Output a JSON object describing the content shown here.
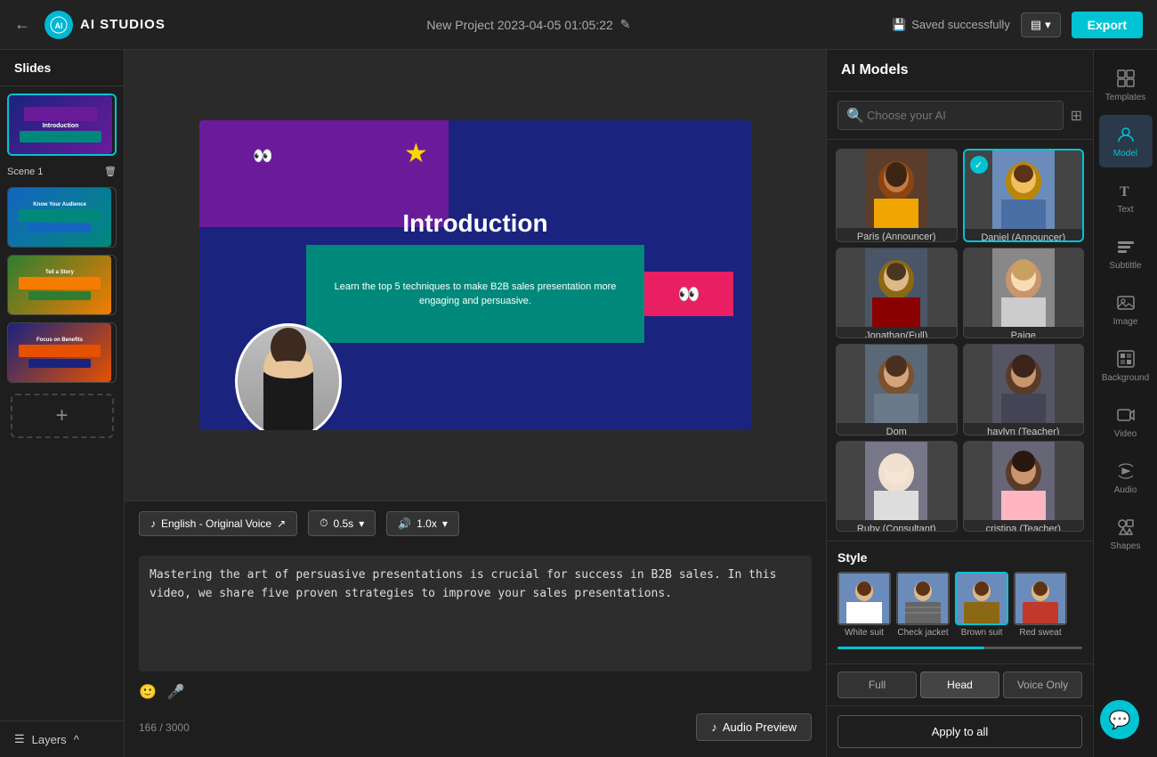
{
  "topbar": {
    "back_arrow": "←",
    "logo_text": "AI STUDIOS",
    "project_title": "New Project 2023-04-05 01:05:22",
    "edit_icon": "✎",
    "saved_label": "Saved successfully",
    "view_label": "▤",
    "view_arrow": "▾",
    "export_label": "Export"
  },
  "slides_panel": {
    "header": "Slides",
    "scene_label": "Scene 1",
    "delete_icon": "🗑",
    "add_icon": "+"
  },
  "layers_bar": {
    "label": "Layers",
    "arrow": "^"
  },
  "canvas": {
    "title": "Introduction",
    "subtitle": "Learn the top 5 techniques to make B2B sales presentation more engaging and persuasive."
  },
  "toolbar": {
    "voice_label": "English - Original Voice",
    "voice_icon": "♪",
    "timing_label": "0.5s",
    "timing_icon": "⏱",
    "speed_label": "1.0x",
    "speed_icon": "🔊"
  },
  "script": {
    "text": "Mastering the art of persuasive presentations is crucial for success in B2B sales. In this video, we share five proven strategies to improve your sales presentations.",
    "char_count": "166",
    "char_max": "3000",
    "audio_preview_label": "Audio Preview",
    "audio_icon": "♪"
  },
  "ai_panel": {
    "header": "AI Models",
    "search_placeholder": "Choose your AI",
    "models": [
      {
        "name": "Paris (Announcer)",
        "selected": false
      },
      {
        "name": "Daniel (Announcer)",
        "selected": true
      },
      {
        "name": "Jonathan(Full) (Consultant)",
        "selected": false
      },
      {
        "name": "Paige",
        "selected": false
      },
      {
        "name": "Dom",
        "selected": false
      },
      {
        "name": "haylyn (Teacher)",
        "selected": false
      },
      {
        "name": "Ruby (Consultant)",
        "selected": false
      },
      {
        "name": "cristina (Teacher)",
        "selected": false
      }
    ],
    "style_title": "Style",
    "styles": [
      {
        "label": "White suit"
      },
      {
        "label": "Check jacket"
      },
      {
        "label": "Brown suit"
      },
      {
        "label": "Red sweat"
      }
    ],
    "position_tabs": [
      {
        "label": "Full"
      },
      {
        "label": "Head",
        "active": true
      },
      {
        "label": "Voice Only"
      }
    ],
    "apply_label": "Apply to all"
  },
  "icon_bar": {
    "items": [
      {
        "label": "Templates",
        "icon": "⊞"
      },
      {
        "label": "Model",
        "icon": "👤",
        "active": true
      },
      {
        "label": "Text",
        "icon": "T"
      },
      {
        "label": "Subtittle",
        "icon": "≡"
      },
      {
        "label": "Image",
        "icon": "🖼"
      },
      {
        "label": "Background",
        "icon": "▦"
      },
      {
        "label": "Video",
        "icon": "▶"
      },
      {
        "label": "Audio",
        "icon": "♫"
      },
      {
        "label": "Shapes",
        "icon": "◇"
      }
    ]
  }
}
